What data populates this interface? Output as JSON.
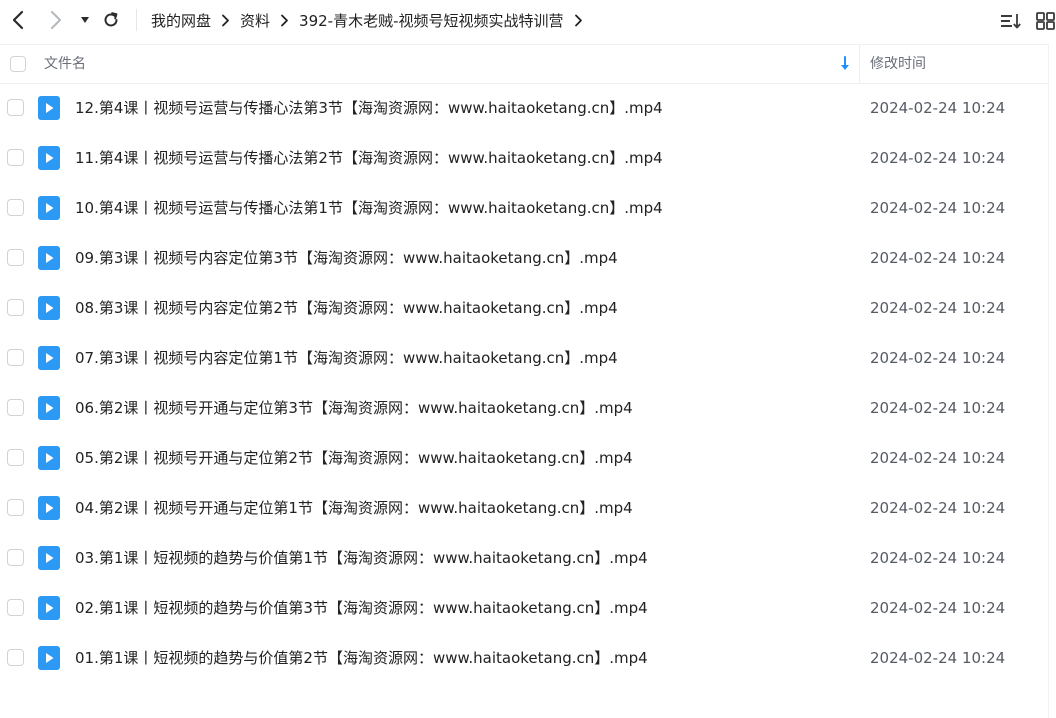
{
  "toolbar": {
    "back_icon": "chevron-left-icon",
    "forward_icon": "chevron-right-icon",
    "history_icon": "caret-down-icon",
    "refresh_icon": "refresh-icon",
    "sort_icon": "sort-list-icon",
    "view_icon": "grid-view-icon"
  },
  "breadcrumb": [
    "我的网盘",
    "资料",
    "392-青木老贼-视频号短视频实战特训营"
  ],
  "header": {
    "name_label": "文件名",
    "date_label": "修改时间",
    "sort_icon": "sort-down-arrow-icon"
  },
  "colors": {
    "accent": "#1e90ff",
    "file_icon": "#2c9af5"
  },
  "files": [
    {
      "name": "12.第4课丨视频号运营与传播心法第3节【海淘资源网：www.haitaoketang.cn】.mp4",
      "modified": "2024-02-24 10:24",
      "icon": "video-file-icon"
    },
    {
      "name": "11.第4课丨视频号运营与传播心法第2节【海淘资源网：www.haitaoketang.cn】.mp4",
      "modified": "2024-02-24 10:24",
      "icon": "video-file-icon"
    },
    {
      "name": "10.第4课丨视频号运营与传播心法第1节【海淘资源网：www.haitaoketang.cn】.mp4",
      "modified": "2024-02-24 10:24",
      "icon": "video-file-icon"
    },
    {
      "name": "09.第3课丨视频号内容定位第3节【海淘资源网：www.haitaoketang.cn】.mp4",
      "modified": "2024-02-24 10:24",
      "icon": "video-file-icon"
    },
    {
      "name": "08.第3课丨视频号内容定位第2节【海淘资源网：www.haitaoketang.cn】.mp4",
      "modified": "2024-02-24 10:24",
      "icon": "video-file-icon"
    },
    {
      "name": "07.第3课丨视频号内容定位第1节【海淘资源网：www.haitaoketang.cn】.mp4",
      "modified": "2024-02-24 10:24",
      "icon": "video-file-icon"
    },
    {
      "name": "06.第2课丨视频号开通与定位第3节【海淘资源网：www.haitaoketang.cn】.mp4",
      "modified": "2024-02-24 10:24",
      "icon": "video-file-icon"
    },
    {
      "name": "05.第2课丨视频号开通与定位第2节【海淘资源网：www.haitaoketang.cn】.mp4",
      "modified": "2024-02-24 10:24",
      "icon": "video-file-icon"
    },
    {
      "name": "04.第2课丨视频号开通与定位第1节【海淘资源网：www.haitaoketang.cn】.mp4",
      "modified": "2024-02-24 10:24",
      "icon": "video-file-icon"
    },
    {
      "name": "03.第1课丨短视频的趋势与价值第1节【海淘资源网：www.haitaoketang.cn】.mp4",
      "modified": "2024-02-24 10:24",
      "icon": "video-file-icon"
    },
    {
      "name": "02.第1课丨短视频的趋势与价值第3节【海淘资源网：www.haitaoketang.cn】.mp4",
      "modified": "2024-02-24 10:24",
      "icon": "video-file-icon"
    },
    {
      "name": "01.第1课丨短视频的趋势与价值第2节【海淘资源网：www.haitaoketang.cn】.mp4",
      "modified": "2024-02-24 10:24",
      "icon": "video-file-icon"
    }
  ]
}
